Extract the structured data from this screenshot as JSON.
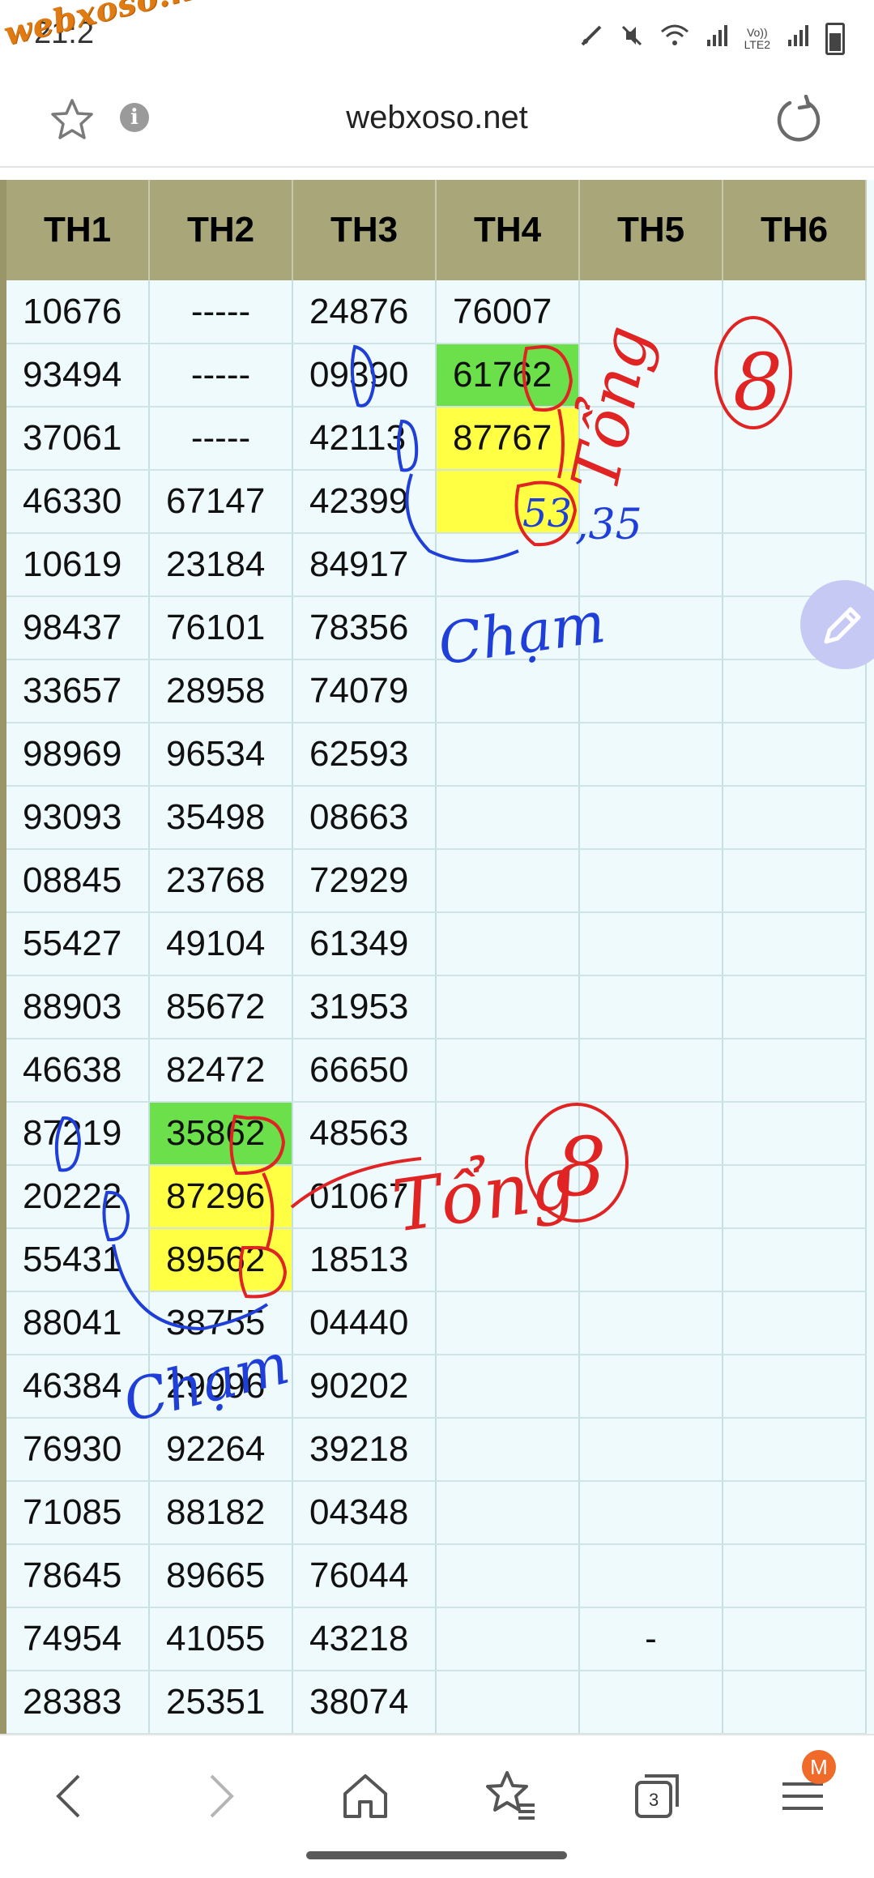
{
  "status_bar": {
    "time": "21:2",
    "watermark": "webxoso.net",
    "network_label_top": "Vo))",
    "network_label_bottom": "LTE2"
  },
  "browser": {
    "url": "webxoso.net",
    "icons": [
      "star-icon",
      "info-icon",
      "reload-icon"
    ]
  },
  "table": {
    "headers": [
      "TH1",
      "TH2",
      "TH3",
      "TH4",
      "TH5",
      "TH6"
    ],
    "rows": [
      [
        "10676",
        "-----",
        "24876",
        "76007",
        "",
        ""
      ],
      [
        "93494",
        "-----",
        "09390",
        "61762",
        "",
        ""
      ],
      [
        "37061",
        "-----",
        "42113",
        "87767",
        "",
        ""
      ],
      [
        "46330",
        "67147",
        "42399",
        "",
        "",
        ""
      ],
      [
        "10619",
        "23184",
        "84917",
        "",
        "",
        ""
      ],
      [
        "98437",
        "76101",
        "78356",
        "",
        "",
        ""
      ],
      [
        "33657",
        "28958",
        "74079",
        "",
        "",
        ""
      ],
      [
        "98969",
        "96534",
        "62593",
        "",
        "",
        ""
      ],
      [
        "93093",
        "35498",
        "08663",
        "",
        "",
        ""
      ],
      [
        "08845",
        "23768",
        "72929",
        "",
        "",
        ""
      ],
      [
        "55427",
        "49104",
        "61349",
        "",
        "",
        ""
      ],
      [
        "88903",
        "85672",
        "31953",
        "",
        "",
        ""
      ],
      [
        "46638",
        "82472",
        "66650",
        "",
        "",
        ""
      ],
      [
        "87219",
        "35862",
        "48563",
        "",
        "",
        ""
      ],
      [
        "20222",
        "87296",
        "01067",
        "",
        "",
        ""
      ],
      [
        "55431",
        "89562",
        "18513",
        "",
        "",
        ""
      ],
      [
        "88041",
        "38755",
        "04440",
        "",
        "",
        ""
      ],
      [
        "46384",
        "29996",
        "90202",
        "",
        "",
        ""
      ],
      [
        "76930",
        "92264",
        "39218",
        "",
        "",
        ""
      ],
      [
        "71085",
        "88182",
        "04348",
        "",
        "",
        ""
      ],
      [
        "78645",
        "89665",
        "76044",
        "",
        "",
        ""
      ],
      [
        "74954",
        "41055",
        "43218",
        "",
        "-",
        ""
      ],
      [
        "28383",
        "25351",
        "38074",
        "",
        "",
        ""
      ]
    ],
    "highlight_colors": {
      "green": "#6be04a",
      "yellow": "#ffff44",
      "header": "#a9a77a"
    }
  },
  "annotations": {
    "top_sum_label": "Tổng",
    "top_sum_value": "8",
    "top_pair": "53",
    "top_pair_reverse": ",35",
    "top_note": "Chạm",
    "bottom_sum_label": "Tổng",
    "bottom_sum_value": "8",
    "bottom_note": "Chạm",
    "ink_red": "#e02424",
    "ink_blue": "#1f3fd8"
  },
  "bottom_nav": {
    "tab_count": "3",
    "profile_badge": "M",
    "icons": [
      "back-icon",
      "forward-icon",
      "home-icon",
      "bookmarks-icon",
      "tabs-icon",
      "menu-icon"
    ]
  }
}
